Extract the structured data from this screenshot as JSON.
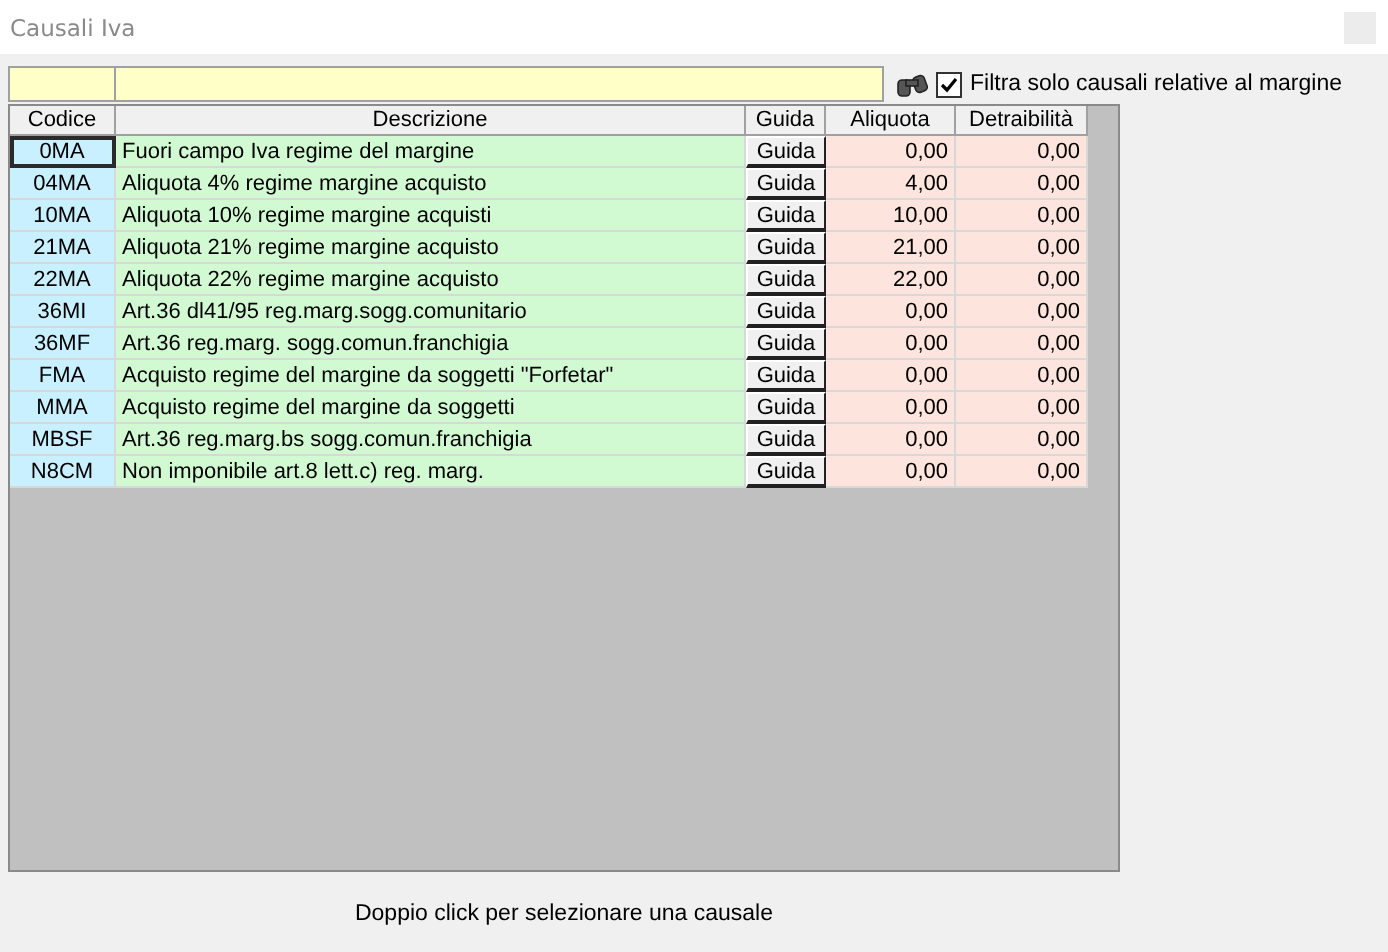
{
  "window": {
    "title": "Causali Iva"
  },
  "filter": {
    "label": "Filtra solo causali relative al margine",
    "checked": true
  },
  "table": {
    "columns": [
      "Codice",
      "Descrizione",
      "Guida",
      "Aliquota",
      "Detraibilità"
    ],
    "rows": [
      {
        "code": "0MA",
        "description": "Fuori campo Iva regime del margine",
        "guide": "Guida",
        "rate": "0,00",
        "deductibility": "0,00",
        "selected": true
      },
      {
        "code": "04MA",
        "description": "Aliquota 4% regime margine acquisto",
        "guide": "Guida",
        "rate": "4,00",
        "deductibility": "0,00",
        "selected": false
      },
      {
        "code": "10MA",
        "description": "Aliquota 10% regime margine acquisti",
        "guide": "Guida",
        "rate": "10,00",
        "deductibility": "0,00",
        "selected": false
      },
      {
        "code": "21MA",
        "description": "Aliquota 21% regime margine acquisto",
        "guide": "Guida",
        "rate": "21,00",
        "deductibility": "0,00",
        "selected": false
      },
      {
        "code": "22MA",
        "description": "Aliquota 22% regime margine acquisto",
        "guide": "Guida",
        "rate": "22,00",
        "deductibility": "0,00",
        "selected": false
      },
      {
        "code": "36MI",
        "description": "Art.36 dl41/95 reg.marg.sogg.comunitario",
        "guide": "Guida",
        "rate": "0,00",
        "deductibility": "0,00",
        "selected": false
      },
      {
        "code": "36MF",
        "description": "Art.36 reg.marg. sogg.comun.franchigia",
        "guide": "Guida",
        "rate": "0,00",
        "deductibility": "0,00",
        "selected": false
      },
      {
        "code": "FMA",
        "description": "Acquisto regime del margine da soggetti \"Forfetar\"",
        "guide": "Guida",
        "rate": "0,00",
        "deductibility": "0,00",
        "selected": false
      },
      {
        "code": "MMA",
        "description": "Acquisto regime del margine da soggetti",
        "guide": "Guida",
        "rate": "0,00",
        "deductibility": "0,00",
        "selected": false
      },
      {
        "code": "MBSF",
        "description": "Art.36 reg.marg.bs sogg.comun.franchigia",
        "guide": "Guida",
        "rate": "0,00",
        "deductibility": "0,00",
        "selected": false
      },
      {
        "code": "N8CM",
        "description": "Non imponibile art.8 lett.c) reg. marg.",
        "guide": "Guida",
        "rate": "0,00",
        "deductibility": "0,00",
        "selected": false
      }
    ]
  },
  "status_text": "Doppio click per selezionare una causale"
}
